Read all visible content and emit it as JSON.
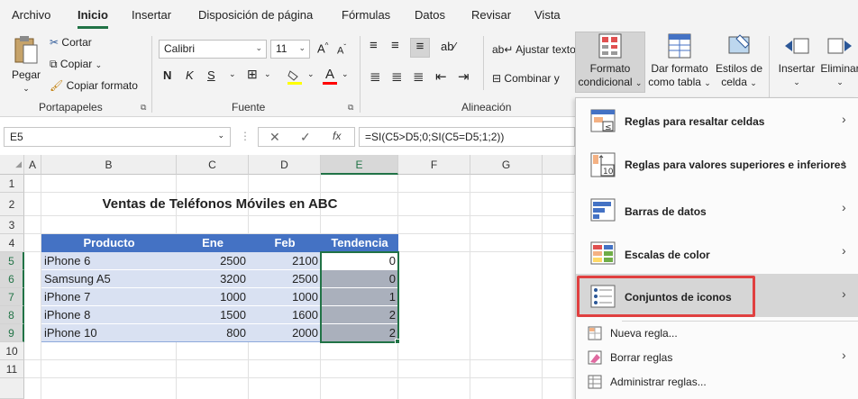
{
  "tabs": [
    "Archivo",
    "Inicio",
    "Insertar",
    "Disposición de página",
    "Fórmulas",
    "Datos",
    "Revisar",
    "Vista"
  ],
  "clipboard": {
    "paste": "Pegar",
    "cut": "Cortar",
    "copy": "Copiar",
    "format_painter": "Copiar formato",
    "group": "Portapapeles"
  },
  "font": {
    "name": "Calibri",
    "size": "11",
    "group": "Fuente",
    "bold": "N",
    "italic": "K",
    "underline": "S",
    "font_color": "A",
    "font_color_value": "#ff0000",
    "fill_color_value": "#ffff00"
  },
  "alignment": {
    "wrap": "Ajustar texto",
    "merge": "Combinar y",
    "group": "Alineación"
  },
  "styles": {
    "conditional_line1": "Formato",
    "conditional_line2": "condicional",
    "table_line1": "Dar formato",
    "table_line2": "como tabla",
    "cell_line1": "Estilos de",
    "cell_line2": "celda"
  },
  "cells_group": {
    "insert": "Insertar",
    "delete": "Eliminar"
  },
  "formula_bar": {
    "name_box": "E5",
    "formula": "=SI(C5>D5;0;SI(C5=D5;1;2))",
    "fx": "fx"
  },
  "columns": [
    "A",
    "B",
    "C",
    "D",
    "E",
    "F",
    "G"
  ],
  "rows": [
    "1",
    "2",
    "3",
    "4",
    "5",
    "6",
    "7",
    "8",
    "9",
    "10",
    "11"
  ],
  "sheet": {
    "title": "Ventas de Teléfonos Móviles en ABC",
    "headers": [
      "Producto",
      "Ene",
      "Feb",
      "Tendencia"
    ],
    "data": [
      [
        "iPhone 6",
        "2500",
        "2100",
        "0"
      ],
      [
        "Samsung A5",
        "3200",
        "2500",
        "0"
      ],
      [
        "iPhone 7",
        "1000",
        "1000",
        "1"
      ],
      [
        "iPhone 8",
        "1500",
        "1600",
        "2"
      ],
      [
        "iPhone 10",
        "800",
        "2000",
        "2"
      ]
    ],
    "header_color": "#4472c4",
    "row_color": "#d9e1f2"
  },
  "menu": {
    "items": [
      "Reglas para resaltar celdas",
      "Reglas para valores superiores e inferiores",
      "Barras de datos",
      "Escalas de color",
      "Conjuntos de iconos"
    ],
    "highlight_icon_text": "≤",
    "top_bottom_icon_text": "10",
    "secondary": [
      "Nueva regla...",
      "Borrar reglas",
      "Administrar reglas..."
    ]
  },
  "highlight_color": "#e04040"
}
